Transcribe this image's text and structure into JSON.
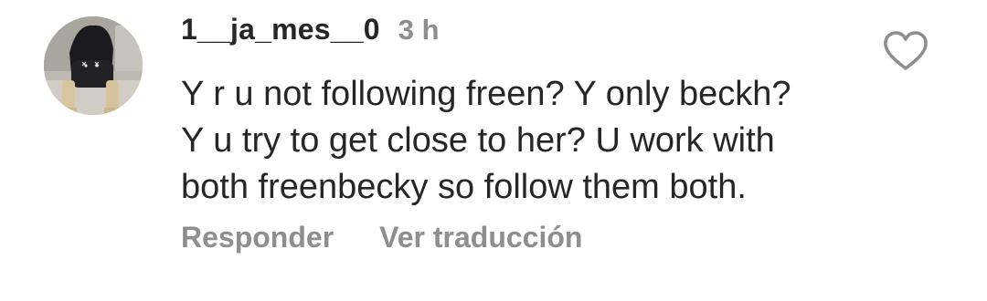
{
  "comment": {
    "username": "1__ja_mes__0",
    "timestamp": "3 h",
    "text_lines": [
      "Y r u not following freen? Y only beckh?",
      "Y u try to get close to her? U work with",
      "both freenbecky so follow them both."
    ],
    "reply_label": "Responder",
    "translate_label": "Ver traducción",
    "like_icon": "heart-outline-icon",
    "avatar_icon": "profile-photo"
  },
  "colors": {
    "text_primary": "#262626",
    "text_secondary": "#8e8e8e",
    "icon_stroke": "#8e8e8e",
    "background": "#ffffff"
  }
}
